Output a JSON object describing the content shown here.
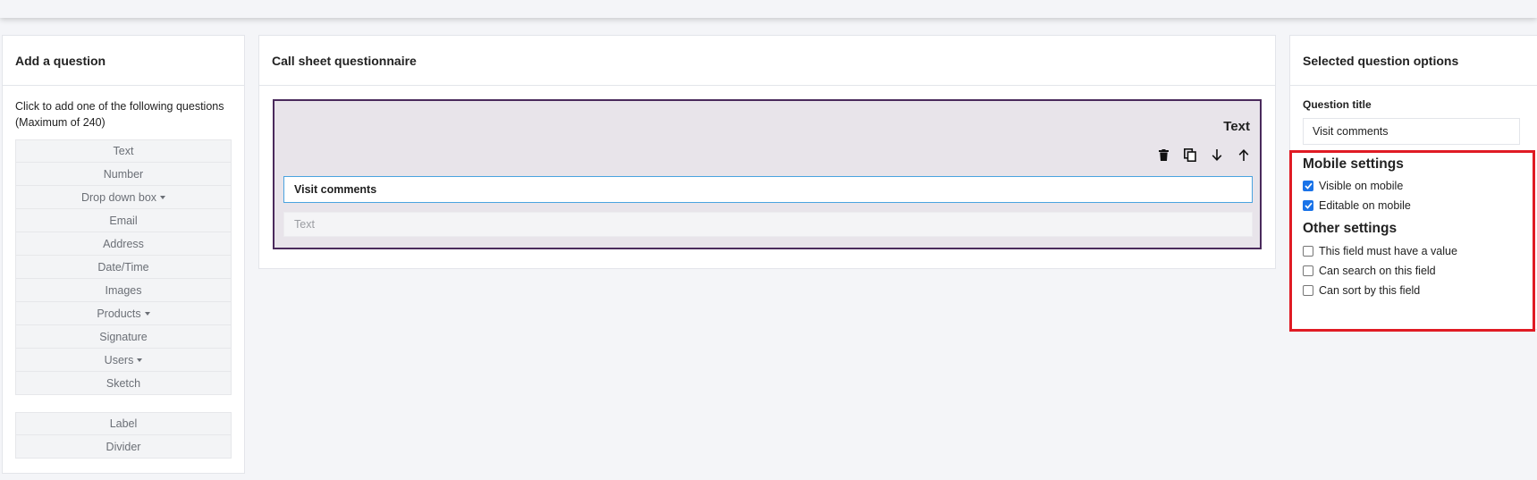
{
  "add_question": {
    "title": "Add a question",
    "intro": "Click to add one of the following questions (Maximum of 240)",
    "types": [
      {
        "label": "Text",
        "dropdown": false
      },
      {
        "label": "Number",
        "dropdown": false
      },
      {
        "label": "Drop down box",
        "dropdown": true
      },
      {
        "label": "Email",
        "dropdown": false
      },
      {
        "label": "Address",
        "dropdown": false
      },
      {
        "label": "Date/Time",
        "dropdown": false
      },
      {
        "label": "Images",
        "dropdown": false
      },
      {
        "label": "Products",
        "dropdown": true
      },
      {
        "label": "Signature",
        "dropdown": false
      },
      {
        "label": "Users",
        "dropdown": true
      },
      {
        "label": "Sketch",
        "dropdown": false
      }
    ],
    "extras": [
      {
        "label": "Label"
      },
      {
        "label": "Divider"
      }
    ]
  },
  "questionnaire": {
    "title": "Call sheet questionnaire",
    "question": {
      "type": "Text",
      "title_value": "Visit comments",
      "answer_placeholder": "Text",
      "tools": [
        "trash-icon",
        "copy-icon",
        "arrow-down-icon",
        "arrow-up-icon"
      ]
    }
  },
  "options": {
    "title": "Selected question options",
    "question_title_label": "Question title",
    "question_title_value": "Visit comments",
    "mobile_settings": {
      "heading": "Mobile settings",
      "items": [
        {
          "label": "Visible on mobile",
          "checked": true
        },
        {
          "label": "Editable on mobile",
          "checked": true
        }
      ]
    },
    "other_settings": {
      "heading": "Other settings",
      "items": [
        {
          "label": "This field must have a value",
          "checked": false
        },
        {
          "label": "Can search on this field",
          "checked": false
        },
        {
          "label": "Can sort by this field",
          "checked": false
        }
      ]
    }
  },
  "colors": {
    "highlight": "#e01b24",
    "card_border": "#4a2a5c",
    "card_bg": "#e8e4ea",
    "input_focus": "#4aa3df",
    "checkbox_checked": "#1a73e8"
  }
}
